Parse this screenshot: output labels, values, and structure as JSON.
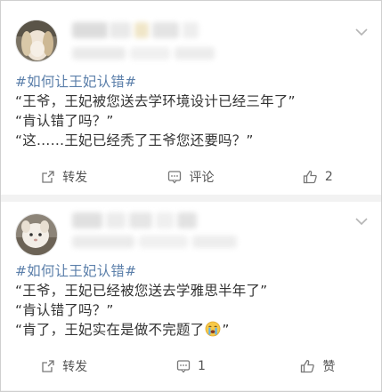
{
  "posts": [
    {
      "hashtag": "#如何让王妃认错#",
      "lines": [
        "“王爷，王妃被您送去学环境设计已经三年了”",
        "“肯认错了吗？”",
        "“这……王妃已经秃了王爷您还要吗？”"
      ],
      "actions": {
        "repost_label": "转发",
        "comment_label": "评论",
        "like_label": "2"
      }
    },
    {
      "hashtag": "#如何让王妃认错#",
      "lines": [
        "“王爷，王妃已经被您送去学雅思半年了”",
        "“肯认错了吗？”",
        "“肯了，王妃实在是做不完题了",
        "”"
      ],
      "emoji": "crying-face",
      "actions": {
        "repost_label": "转发",
        "comment_label": "1",
        "like_label": "赞"
      }
    }
  ],
  "colors": {
    "hashtag": "#5b7faa",
    "text": "#333333",
    "action_text": "#555555",
    "background": "#f2f2f2"
  }
}
